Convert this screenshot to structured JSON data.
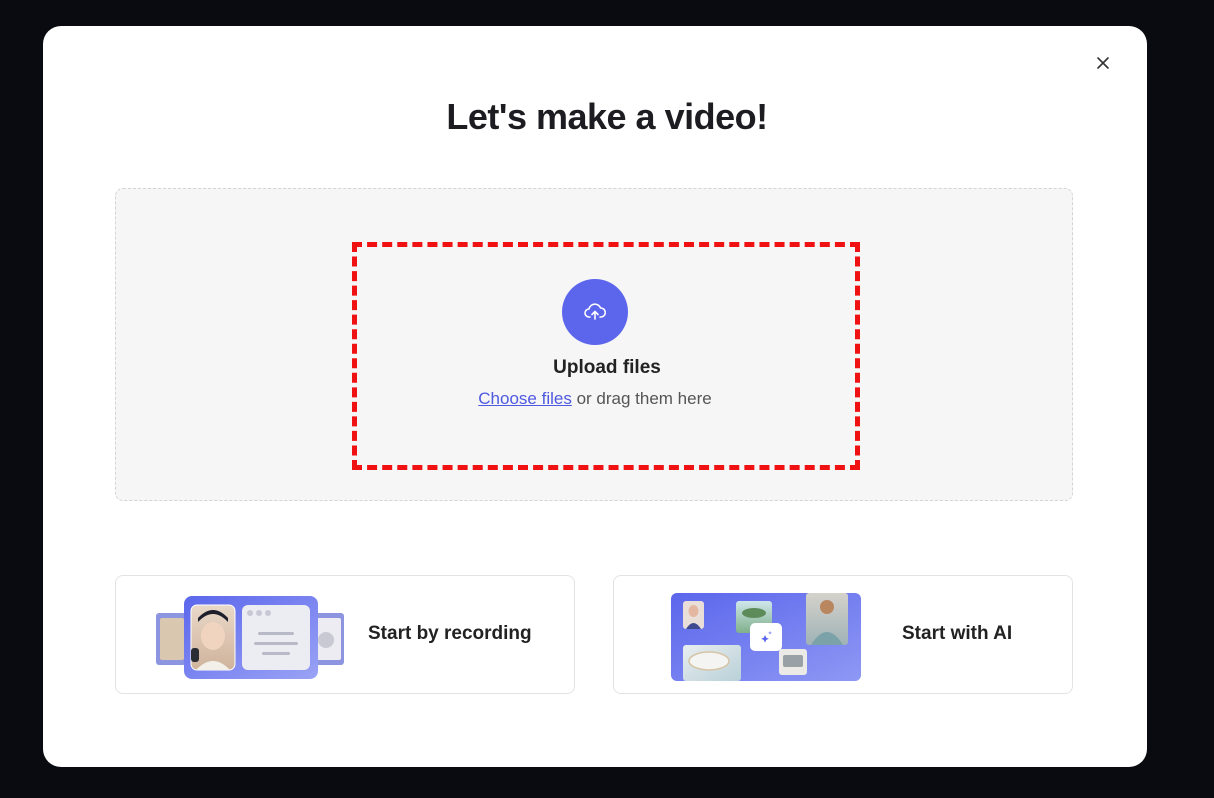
{
  "modal": {
    "title": "Let's make a video!",
    "close_icon": "close-icon"
  },
  "upload": {
    "icon": "cloud-upload-icon",
    "title": "Upload files",
    "choose_link": "Choose files",
    "drag_text": " or drag them here"
  },
  "options": {
    "recording_label": "Start by recording",
    "ai_label": "Start with AI"
  },
  "colors": {
    "accent": "#5b66ec",
    "highlight": "#f01212"
  }
}
